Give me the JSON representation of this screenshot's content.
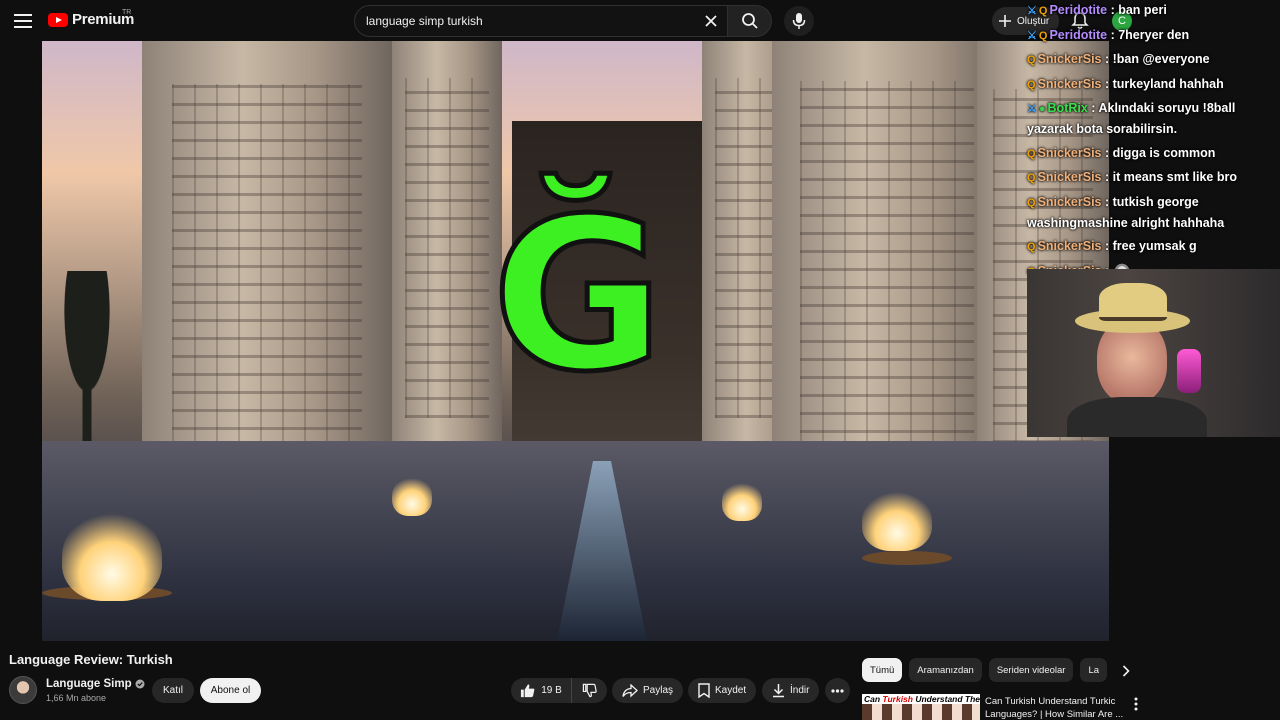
{
  "header": {
    "logo_text": "Premium",
    "country_code": "TR",
    "search_value": "language simp turkish",
    "create_label": "Oluştur",
    "avatar_letter": "C"
  },
  "video": {
    "overlay_glyph": "Ğ"
  },
  "chat": {
    "messages": [
      {
        "badges": [
          "mod",
          "q"
        ],
        "user": "Peridotite",
        "user_color": "#b48cff",
        "text": ": ban peri"
      },
      {
        "badges": [
          "mod",
          "q"
        ],
        "user": "Peridotite",
        "user_color": "#b48cff",
        "text": ": 7heryer den"
      },
      {
        "badges": [
          "q"
        ],
        "user": "SnickerSis",
        "user_color": "#f0b07a",
        "text": ": !ban @everyone"
      },
      {
        "badges": [
          "q"
        ],
        "user": "SnickerSis",
        "user_color": "#f0b07a",
        "text": ": turkeyland hahhah"
      },
      {
        "badges": [
          "mod",
          "verified"
        ],
        "user": "BotRix",
        "user_color": "#37e04b",
        "text": ": Aklındaki soruyu !8ball yazarak bota sorabilirsin."
      },
      {
        "badges": [
          "q"
        ],
        "user": "SnickerSis",
        "user_color": "#f0b07a",
        "text": ": digga is common"
      },
      {
        "badges": [
          "q"
        ],
        "user": "SnickerSis",
        "user_color": "#f0b07a",
        "text": ": it means smt like bro"
      },
      {
        "badges": [
          "q"
        ],
        "user": "SnickerSis",
        "user_color": "#f0b07a",
        "text": ": tutkish george washingmashine alright hahhaha"
      },
      {
        "badges": [
          "q"
        ],
        "user": "SnickerSis",
        "user_color": "#f0b07a",
        "text": ": free yumsak g"
      },
      {
        "badges": [
          "q"
        ],
        "user": "SnickerSis",
        "user_color": "#f0b07a",
        "text": ":",
        "emote": true
      }
    ]
  },
  "info": {
    "title": "Language Review: Turkish",
    "channel_name": "Language Simp",
    "subscribers": "1,66 Mn abone",
    "join_label": "Katıl",
    "subscribe_label": "Abone ol",
    "like_count": "19 B",
    "share_label": "Paylaş",
    "save_label": "Kaydet",
    "download_label": "İndir"
  },
  "chips": [
    "Tümü",
    "Aramanızdan",
    "Seriden videolar",
    "La"
  ],
  "recommendation": {
    "thumb_text_pre": "Can ",
    "thumb_text_em": "Turkish",
    "thumb_text_post": " Understand Them?",
    "title": "Can Turkish Understand Turkic Languages? | How Similar Are ..."
  },
  "colors": {
    "brand_red": "#ff0000",
    "glyph_green": "#3cf022",
    "page_bg": "#0f0f0f"
  }
}
